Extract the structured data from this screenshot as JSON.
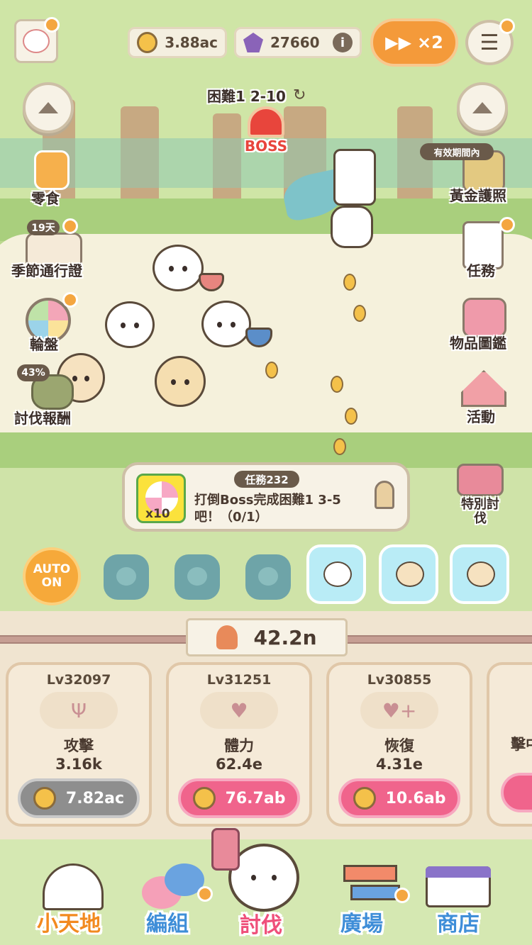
{
  "hud": {
    "coins": "3.88ac",
    "gems": "27660",
    "speed": "×2",
    "stage": "困難1 2-10",
    "boss_label": "BOSS"
  },
  "left_menu": {
    "snack": "零食",
    "pass_badge": "19天",
    "pass": "季節通行證",
    "wheel": "輪盤",
    "reward_badge": "43%",
    "reward": "討伐報酬"
  },
  "right_menu": {
    "gold_badge": "有效期間內",
    "gold": "黃金護照",
    "tasks": "任務",
    "catalog": "物品圖鑑",
    "event": "活動",
    "special": "特別討伐"
  },
  "quest": {
    "count": "x10",
    "tag": "任務232",
    "text": "打倒Boss完成困難1 3-5吧！（0/1）"
  },
  "auto": {
    "line1": "AUTO",
    "line2": "ON"
  },
  "power": "42.2n",
  "cards": [
    {
      "level": "Lv32097",
      "name": "攻擊",
      "value": "3.16k",
      "cost": "7.82ac",
      "icon": "trident-icon"
    },
    {
      "level": "Lv31251",
      "name": "體力",
      "value": "62.4e",
      "cost": "76.7ab",
      "icon": "heart-icon"
    },
    {
      "level": "Lv30855",
      "name": "恢復",
      "value": "4.31e",
      "cost": "10.6ab",
      "icon": "heart-plus-icon"
    },
    {
      "level": "",
      "name": "擊中",
      "value": "",
      "cost": "",
      "icon": "crit-icon"
    }
  ],
  "nav": {
    "home": "小天地",
    "team": "編組",
    "hunt": "討伐",
    "plaza": "廣場",
    "shop": "商店"
  },
  "colors": {
    "orange": "#f49a3a",
    "pink": "#f0648c",
    "nav_active": "#ef4f7a",
    "nav_home": "#f28a1f",
    "nav_blue": "#3f8ed8"
  }
}
